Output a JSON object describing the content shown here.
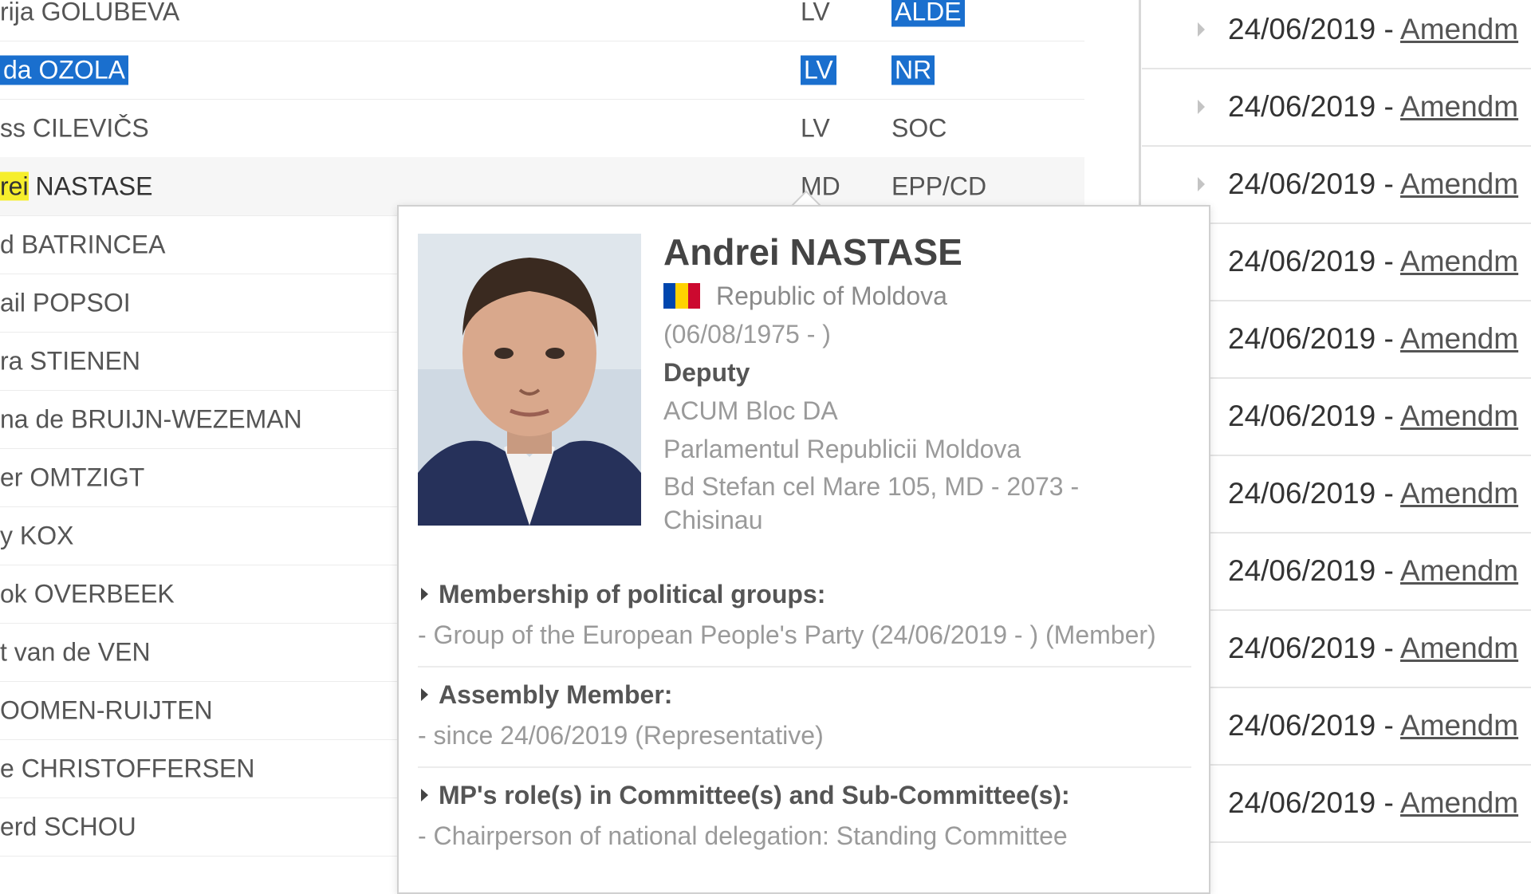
{
  "members": [
    {
      "name": "rija GOLUBEVA",
      "country": "LV",
      "group": "ALDE",
      "group_selected": true
    },
    {
      "name_selected": "da OZOLA",
      "country_selected": "LV",
      "group_selected_text": "NR"
    },
    {
      "name": "ss CILEVIČS",
      "country": "LV",
      "group": "SOC"
    },
    {
      "name_hl": "rei",
      "name_rest": " NASTASE",
      "country": "MD",
      "group": "EPP/CD",
      "hovered": true
    },
    {
      "name": "d BATRINCEA"
    },
    {
      "name": "ail POPSOI"
    },
    {
      "name": "ra STIENEN"
    },
    {
      "name": "na de BRUIJN-WEZEMAN"
    },
    {
      "name": "er OMTZIGT"
    },
    {
      "name": "y KOX"
    },
    {
      "name": "ok OVERBEEK"
    },
    {
      "name": "t van de VEN"
    },
    {
      "name": " OOMEN-RUIJTEN"
    },
    {
      "name": "e CHRISTOFFERSEN"
    },
    {
      "name": "erd SCHOU"
    }
  ],
  "amendments": [
    {
      "date": "24/06/2019 - ",
      "link": "Amendm"
    },
    {
      "date": "24/06/2019 - ",
      "link": "Amendm"
    },
    {
      "date": "24/06/2019 - ",
      "link": "Amendm"
    },
    {
      "date": "24/06/2019 - ",
      "link": "Amendm"
    },
    {
      "date": "24/06/2019 - ",
      "link": "Amendm"
    },
    {
      "date": "24/06/2019 - ",
      "link": "Amendm"
    },
    {
      "date": "24/06/2019 - ",
      "link": "Amendm"
    },
    {
      "date": "24/06/2019 - ",
      "link": "Amendm"
    },
    {
      "date": "24/06/2019 - ",
      "link": "Amendm"
    },
    {
      "date": "24/06/2019 - ",
      "link": "Amendm"
    },
    {
      "date": "24/06/2019 - ",
      "link": "Amendm"
    }
  ],
  "profile": {
    "name": "Andrei NASTASE",
    "country": "Republic of Moldova",
    "flag_colors": [
      "#0046ae",
      "#ffd200",
      "#cc092f"
    ],
    "dates": "(06/08/1975 - )",
    "role": "Deputy",
    "party": "ACUM Bloc DA",
    "parliament": "Parlamentul Republicii Moldova",
    "address": "Bd Stefan cel Mare 105, MD - 2073 - Chisinau",
    "sections": [
      {
        "title": "Membership of political groups:",
        "body": "- Group of the European People's Party (24/06/2019 - ) (Member)"
      },
      {
        "title": "Assembly Member:",
        "body": "- since 24/06/2019  (Representative)"
      },
      {
        "title": "MP's role(s) in Committee(s) and Sub-Committee(s):",
        "body": "- Chairperson of national delegation: Standing Committee"
      }
    ]
  },
  "colors": {
    "selection": "#1a6fce",
    "highlight": "#f6ee2c"
  }
}
